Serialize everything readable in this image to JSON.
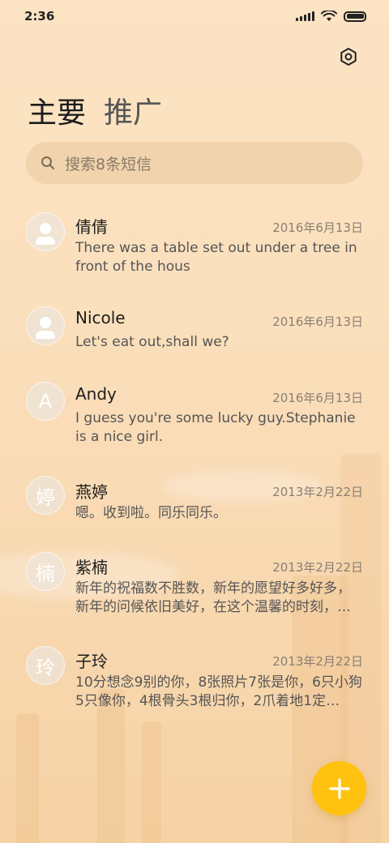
{
  "status": {
    "time": "2:36"
  },
  "tabs": [
    {
      "label": "主要",
      "active": true
    },
    {
      "label": "推广",
      "active": false
    }
  ],
  "search": {
    "placeholder": "搜索8条短信"
  },
  "conversations": [
    {
      "name": "倩倩",
      "date": "2016年6月13日",
      "preview": "There was a table set out under a tree in front of the hous",
      "avatar": {
        "type": "person-icon"
      }
    },
    {
      "name": "Nicole",
      "date": "2016年6月13日",
      "preview": "Let's eat out,shall we?",
      "avatar": {
        "type": "person-icon"
      }
    },
    {
      "name": "Andy",
      "date": "2016年6月13日",
      "preview": "I guess you're some lucky guy.Stephanie is a nice girl.",
      "avatar": {
        "type": "letter",
        "text": "A"
      }
    },
    {
      "name": "燕婷",
      "date": "2013年2月22日",
      "preview": "嗯。收到啦。同乐同乐。",
      "avatar": {
        "type": "letter",
        "text": "婷"
      }
    },
    {
      "name": "紫楠",
      "date": "2013年2月22日",
      "preview": "新年的祝福数不胜数，新年的愿望好多好多，新年的问候依旧美好，在这个温馨的时刻，…",
      "avatar": {
        "type": "letter",
        "text": "楠"
      }
    },
    {
      "name": "子玲",
      "date": "2013年2月22日",
      "preview": "10分想念9别的你，8张照片7张是你，6只小狗5只像你，4根骨头3根归你，2爪着地1定…",
      "avatar": {
        "type": "letter",
        "text": "玲"
      }
    }
  ],
  "icons": {
    "settings": "settings-hex-icon",
    "search": "search-icon",
    "compose": "plus-icon",
    "signal": "signal-icon",
    "wifi": "wifi-icon",
    "battery": "battery-icon"
  },
  "colors": {
    "accent": "#ffc20e",
    "background": "#fbe0bd"
  }
}
